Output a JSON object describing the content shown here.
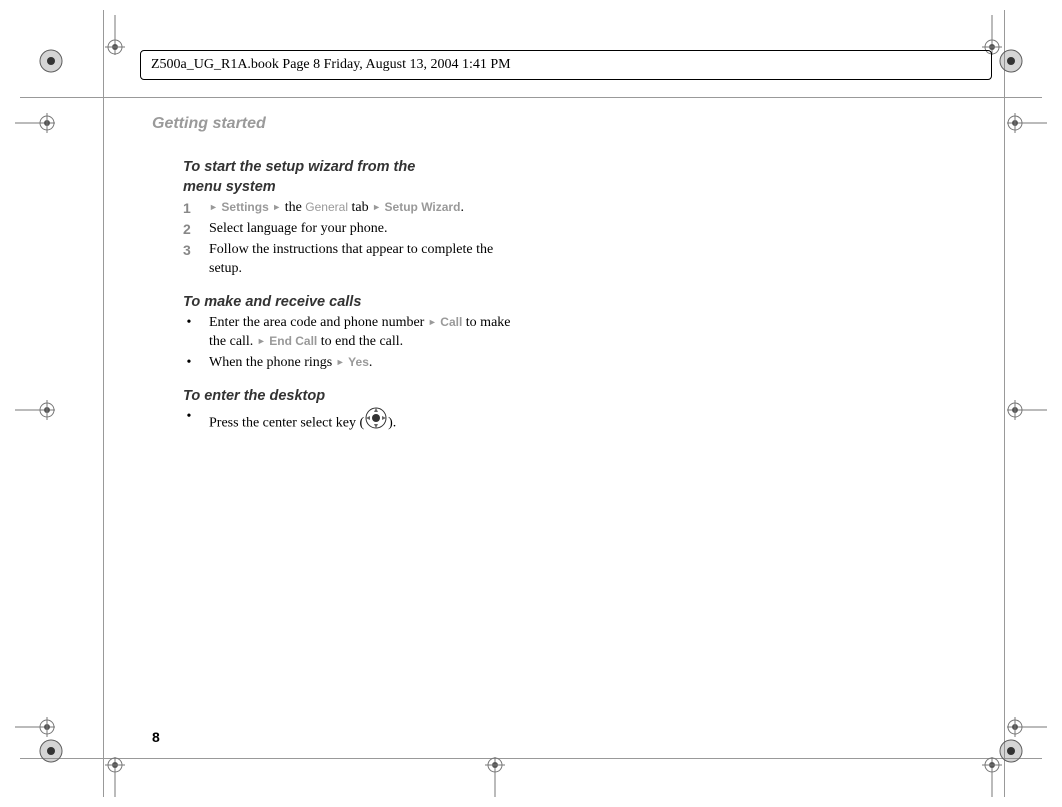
{
  "header": {
    "book_info": "Z500a_UG_R1A.book  Page 8  Friday, August 13, 2004  1:41 PM"
  },
  "section_title": "Getting started",
  "page_number": "8",
  "section1": {
    "heading_l1": "To start the setup wizard from the",
    "heading_l2": "menu system",
    "step1_settings": "Settings",
    "step1_the": "the",
    "step1_general": "General",
    "step1_tab": "tab",
    "step1_wizard": "Setup Wizard",
    "step2": "Select language for your phone.",
    "step3": "Follow the instructions that appear to complete the setup.",
    "num1": "1",
    "num2": "2",
    "num3": "3"
  },
  "section2": {
    "heading": "To make and receive calls",
    "b1_a": "Enter the area code and phone number",
    "b1_call": "Call",
    "b1_b": "to make the call.",
    "b1_endcall": "End Call",
    "b1_c": "to end the call.",
    "b2_a": "When the phone rings",
    "b2_yes": "Yes"
  },
  "section3": {
    "heading": "To enter the desktop",
    "b1_a": "Press the center select key (",
    "b1_b": ")."
  }
}
